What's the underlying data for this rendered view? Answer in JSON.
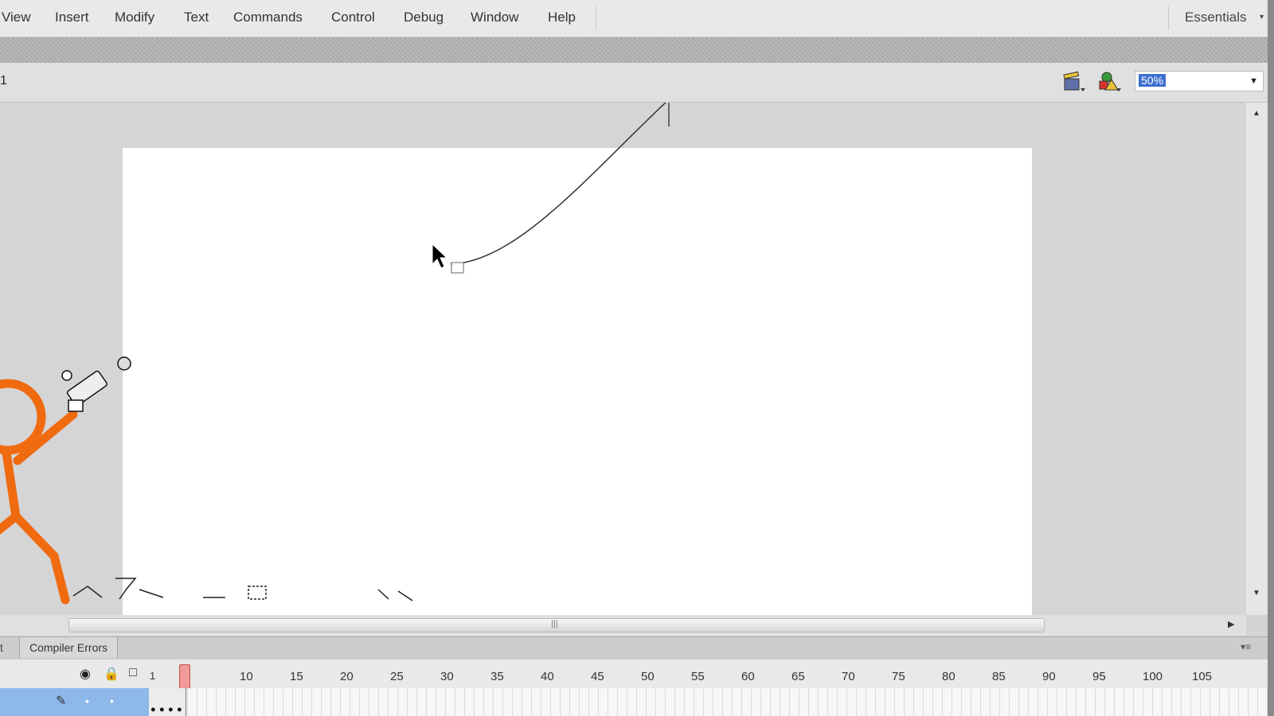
{
  "menu": [
    "View",
    "Insert",
    "Modify",
    "Text",
    "Commands",
    "Control",
    "Debug",
    "Window",
    "Help"
  ],
  "workspace": "Essentials",
  "edit_bar": {
    "scene": "1",
    "zoom": "50%"
  },
  "icons": {
    "edit_scene": "clapperboard-icon",
    "edit_symbol": "symbols-icon",
    "menu_caret": "chevron-down-icon"
  },
  "panel_tabs": {
    "compiler_errors": "Compiler Errors"
  },
  "timeline": {
    "first_frame": "1",
    "frame_ticks": [
      "10",
      "15",
      "20",
      "25",
      "30",
      "35",
      "40",
      "45",
      "50",
      "55",
      "60",
      "65",
      "70",
      "75",
      "80",
      "85",
      "90",
      "95",
      "100",
      "105"
    ],
    "playhead_frame": 5
  },
  "colors": {
    "figure": "#f06a10",
    "layer_selected": "#8eb8ea",
    "playhead": "#f09a9a"
  }
}
